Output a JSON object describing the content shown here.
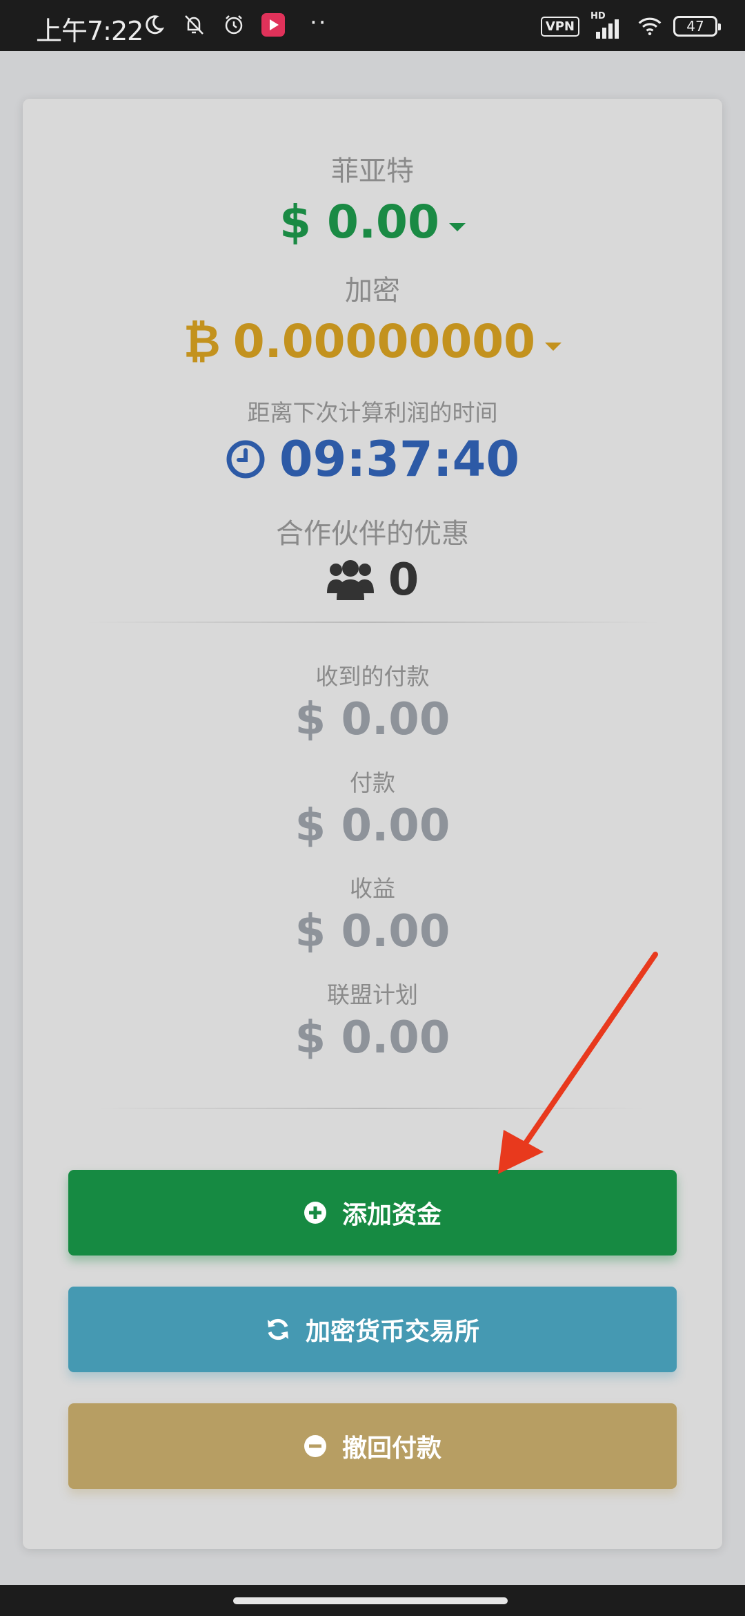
{
  "status_bar": {
    "time": "上午7:22",
    "vpn": "VPN",
    "network": "HD",
    "battery": "47"
  },
  "balances": {
    "fiat_label": "菲亚特",
    "fiat_value": "$ 0.00",
    "crypto_label": "加密",
    "crypto_symbol": "₿",
    "crypto_value": "0.00000000",
    "timer_label": "距离下次计算利润的时间",
    "timer_value": "09:37:40",
    "partners_label": "合作伙伴的优惠",
    "partners_value": "0"
  },
  "stats": [
    {
      "label": "收到的付款",
      "value": "$ 0.00"
    },
    {
      "label": "付款",
      "value": "$ 0.00"
    },
    {
      "label": "收益",
      "value": "$ 0.00"
    },
    {
      "label": "联盟计划",
      "value": "$ 0.00"
    }
  ],
  "actions": {
    "add_funds": "添加资金",
    "exchange": "加密货币交易所",
    "withdraw": "撤回付款"
  },
  "colors": {
    "fiat": "#1a8a44",
    "crypto": "#c3921e",
    "timer": "#2d5aa6",
    "add_funds": "#168a42",
    "exchange": "#4599b2",
    "withdraw": "#b79e63",
    "annotation_arrow": "#e8391d"
  },
  "icons": {
    "moon": "moon-icon",
    "mute": "bell-off-icon",
    "alarm": "alarm-icon",
    "app": "video-app-icon",
    "wifi": "wifi-icon",
    "clock": "clock-icon",
    "users": "users-icon",
    "plus": "plus-circle-icon",
    "refresh": "refresh-icon",
    "minus": "minus-circle-icon"
  }
}
